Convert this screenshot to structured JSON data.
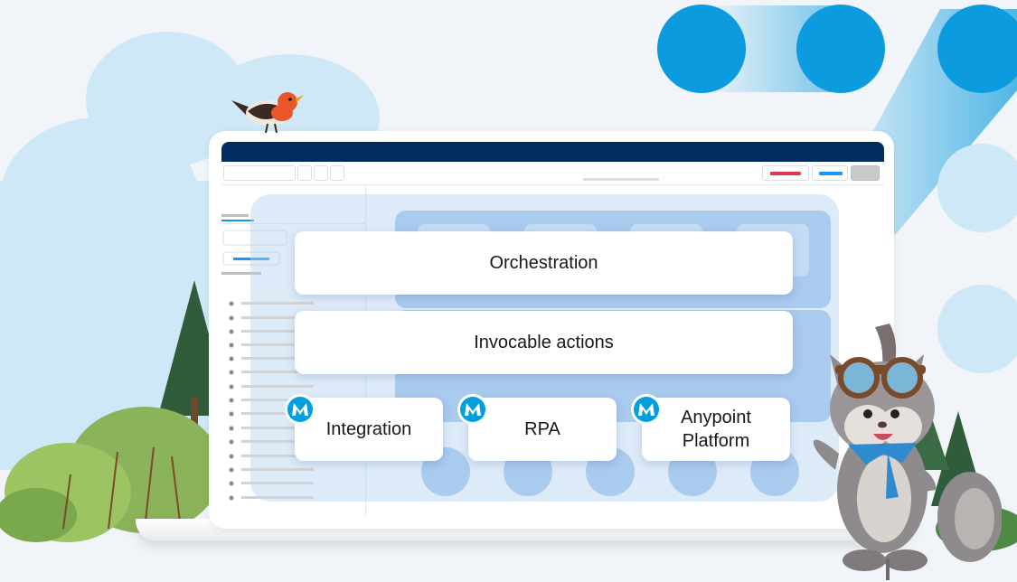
{
  "cards": {
    "orchestration": "Orchestration",
    "invocable_actions": "Invocable actions",
    "integration": "Integration",
    "rpa": "RPA",
    "anypoint_platform": "Anypoint Platform"
  },
  "icons": {
    "mulesoft": "mulesoft-logo-icon",
    "bird": "bird-mascot",
    "squirrel": "squirrel-mascot"
  },
  "colors": {
    "accent": "#0b9bde",
    "navy": "#032d60",
    "mule_blue": "#00a0df",
    "red": "#e03a4e"
  }
}
